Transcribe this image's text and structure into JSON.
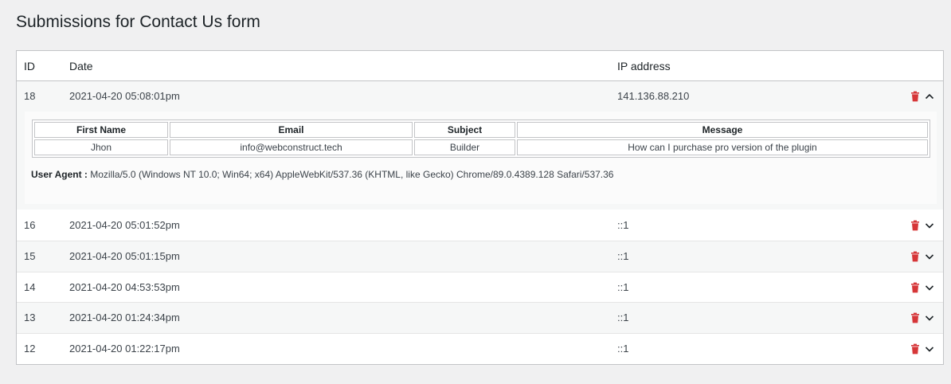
{
  "page": {
    "title": "Submissions for Contact Us form"
  },
  "table": {
    "columns": {
      "id": "ID",
      "date": "Date",
      "ip": "IP address"
    },
    "expanded": {
      "id": "18",
      "date": "2021-04-20 05:08:01pm",
      "ip": "141.136.88.210",
      "fields": {
        "headers": [
          "First Name",
          "Email",
          "Subject",
          "Message"
        ],
        "values": [
          "Jhon",
          "info@webconstruct.tech",
          "Builder",
          "How can I purchase pro version of the plugin"
        ]
      },
      "user_agent_label": "User Agent :",
      "user_agent": "Mozilla/5.0 (Windows NT 10.0; Win64; x64) AppleWebKit/537.36 (KHTML, like Gecko) Chrome/89.0.4389.128 Safari/537.36"
    },
    "rows": [
      {
        "id": "16",
        "date": "2021-04-20 05:01:52pm",
        "ip": "::1"
      },
      {
        "id": "15",
        "date": "2021-04-20 05:01:15pm",
        "ip": "::1"
      },
      {
        "id": "14",
        "date": "2021-04-20 04:53:53pm",
        "ip": "::1"
      },
      {
        "id": "13",
        "date": "2021-04-20 01:24:34pm",
        "ip": "::1"
      },
      {
        "id": "12",
        "date": "2021-04-20 01:22:17pm",
        "ip": "::1"
      }
    ]
  },
  "icons": {
    "delete": "trash-icon",
    "collapse": "chevron-up-icon",
    "expand": "chevron-down-icon"
  },
  "colors": {
    "delete_icon": "#d63638",
    "alt_row": "#f6f7f7",
    "border": "#c3c4c7"
  }
}
